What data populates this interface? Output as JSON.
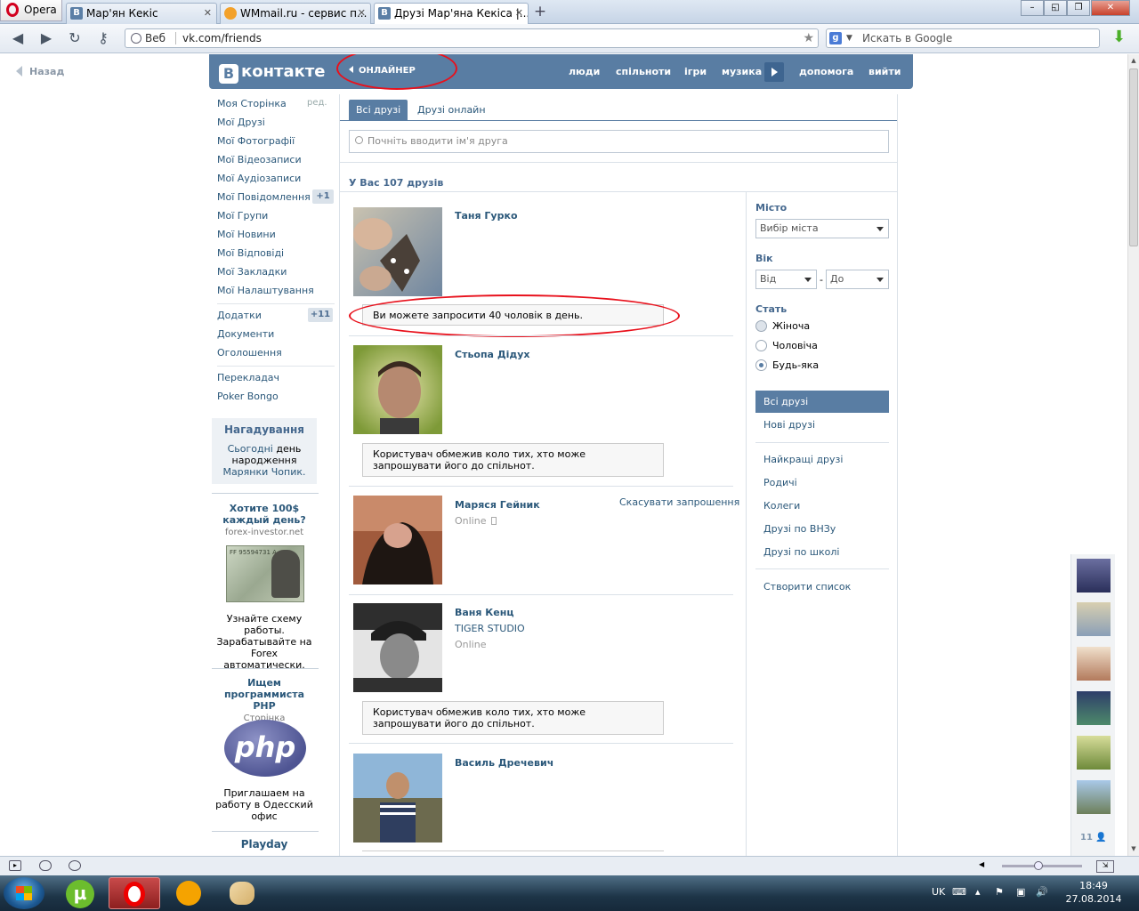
{
  "browser": {
    "app_label": "Opera",
    "tabs": [
      {
        "label": "Мар'ян Кекіс"
      },
      {
        "label": "WMmail.ru - сервис п..."
      },
      {
        "label": "Друзі Мар'яна Кекіса |..."
      }
    ],
    "address_scheme": "Веб",
    "address_url": "vk.com/friends",
    "search_placeholder": "Искать в Google"
  },
  "page": {
    "back_label": "Назад",
    "header": {
      "logo_text": "контакте",
      "logo_letter": "В",
      "app_link": "ОНЛАЙНЕР",
      "nav": [
        "люди",
        "спільноти",
        "ігри",
        "музика",
        "допомога",
        "вийти"
      ]
    },
    "left_menu": {
      "items": [
        "Моя Сторінка",
        "Мої Друзі",
        "Мої Фотографії",
        "Мої Відеозаписи",
        "Мої Аудіозаписи",
        "Мої Повідомлення",
        "Мої Групи",
        "Мої Новини",
        "Мої Відповіді",
        "Мої Закладки",
        "Мої Налаштування"
      ],
      "edit_label": "ред.",
      "messages_badge": "+1",
      "apps": [
        "Додатки",
        "Документи",
        "Оголошення"
      ],
      "apps_badge": "+11",
      "extra": [
        "Перекладач",
        "Poker Bongo"
      ]
    },
    "reminder": {
      "title": "Нагадування",
      "line1_link": "Сьогодні",
      "line1_rest": " день народження",
      "line2": "Марянки Чопик."
    },
    "ads": [
      {
        "title": "Хотите 100$ каждый день?",
        "domain": "forex-investor.net",
        "desc": "Узнайте схему работы. Зарабатывайте на Forex автоматически."
      },
      {
        "title": "Ищем программиста PHP",
        "domain": "Сторінка",
        "desc": "Приглашаем на работу в Одесский офис",
        "logo_text": "php"
      },
      {
        "title": "Playday"
      }
    ],
    "tabs": [
      "Всі друзі",
      "Друзі онлайн"
    ],
    "friend_search_placeholder": "Почніть вводити ім'я друга",
    "friend_count": "У Вас 107 друзів",
    "friends": [
      {
        "name": "Таня Гурко",
        "notice": "Ви можете запросити 40 чоловік в день."
      },
      {
        "name": "Стьопа Дідух",
        "notice": "Користувач обмежив коло тих, хто може запрошувати його до спільнот."
      },
      {
        "name": "Маряся Гейник",
        "status": "Online",
        "action": "Скасувати запрошення"
      },
      {
        "name": "Ваня Кенц",
        "subtitle": "TIGER STUDIO",
        "status": "Online",
        "notice": "Користувач обмежив коло тих, хто може запрошувати його до спільнот."
      },
      {
        "name": "Василь Дречевич"
      }
    ],
    "filters": {
      "city_label": "Місто",
      "city_value": "Вибір міста",
      "age_label": "Вік",
      "age_from": "Від",
      "age_to": "До",
      "age_dash": "-",
      "gender_label": "Стать",
      "gender_options": [
        "Жіноча",
        "Чоловіча",
        "Будь-яка"
      ],
      "gender_selected": "Будь-яка",
      "menu1": [
        "Всі друзі",
        "Нові друзі"
      ],
      "menu2": [
        "Найкращі друзі",
        "Родичі",
        "Колеги",
        "Друзі по ВНЗу",
        "Друзі по школі"
      ],
      "create_list": "Створити список"
    },
    "online_sidebar_count": "11"
  },
  "taskbar": {
    "language": "UK",
    "time": "18:49",
    "date": "27.08.2014"
  },
  "colors": {
    "vk_blue": "#597da3",
    "link": "#2b587a",
    "annotation_red": "#e8111c"
  }
}
